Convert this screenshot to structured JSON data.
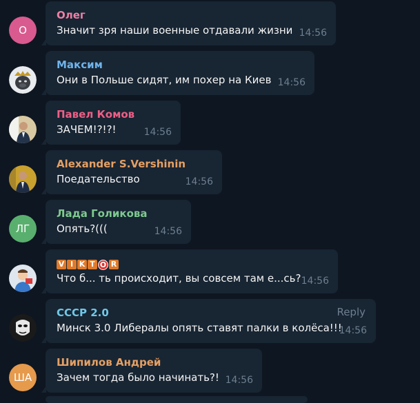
{
  "messages": [
    {
      "name": "Олег",
      "name_color": "#ef7fa5",
      "text": "Значит зря наши военные отдавали жизни",
      "time": "14:56",
      "avatar_initials": "О",
      "avatar_color": "#d95a8f"
    },
    {
      "name": "Максим",
      "name_color": "#6fb4ec",
      "text": "Они в Польше сидят, им похер на Киев",
      "time": "14:56",
      "avatar_icon": "gorilla-avatar-icon"
    },
    {
      "name": "Павел Комов",
      "name_color": "#ee5f86",
      "text": "ЗАЧЕМ!?!?!",
      "time": "14:56",
      "avatar_icon": "person-photo-icon"
    },
    {
      "name": "Alexander S.Vershinin",
      "name_color": "#e5a064",
      "text": "Поедательство",
      "time": "14:56",
      "avatar_icon": "person-photo-icon"
    },
    {
      "name": "Лада Голикова",
      "name_color": "#7ec98f",
      "text": "Опять?(((",
      "time": "14:56",
      "avatar_initials": "ЛГ",
      "avatar_color": "#59b06e"
    },
    {
      "name": "VIKTOR",
      "name_letters": [
        "V",
        "I",
        "K",
        "T",
        "O",
        "R"
      ],
      "text": "Что б... ть происходит, вы совсем там е...сь?",
      "time": "14:56",
      "avatar_icon": "cartoon-avatar-icon"
    },
    {
      "name": "СССР 2.0",
      "name_color": "#6fc8e8",
      "text": "Минск 3.0 Либералы опять ставят палки в колёса!!!",
      "time": "14:56",
      "reply_label": "Reply",
      "avatar_icon": "mask-avatar-icon"
    },
    {
      "name": "Шипилов Андрей",
      "name_color": "#e5a064",
      "text": "Зачем тогда было начинать?!",
      "time": "14:56",
      "avatar_initials": "ША",
      "avatar_color": "#e59a4c"
    }
  ],
  "colors": {
    "background": "#0e1621",
    "bubble": "#182533",
    "text": "#f5f5f5",
    "time": "#6d7f8f"
  }
}
